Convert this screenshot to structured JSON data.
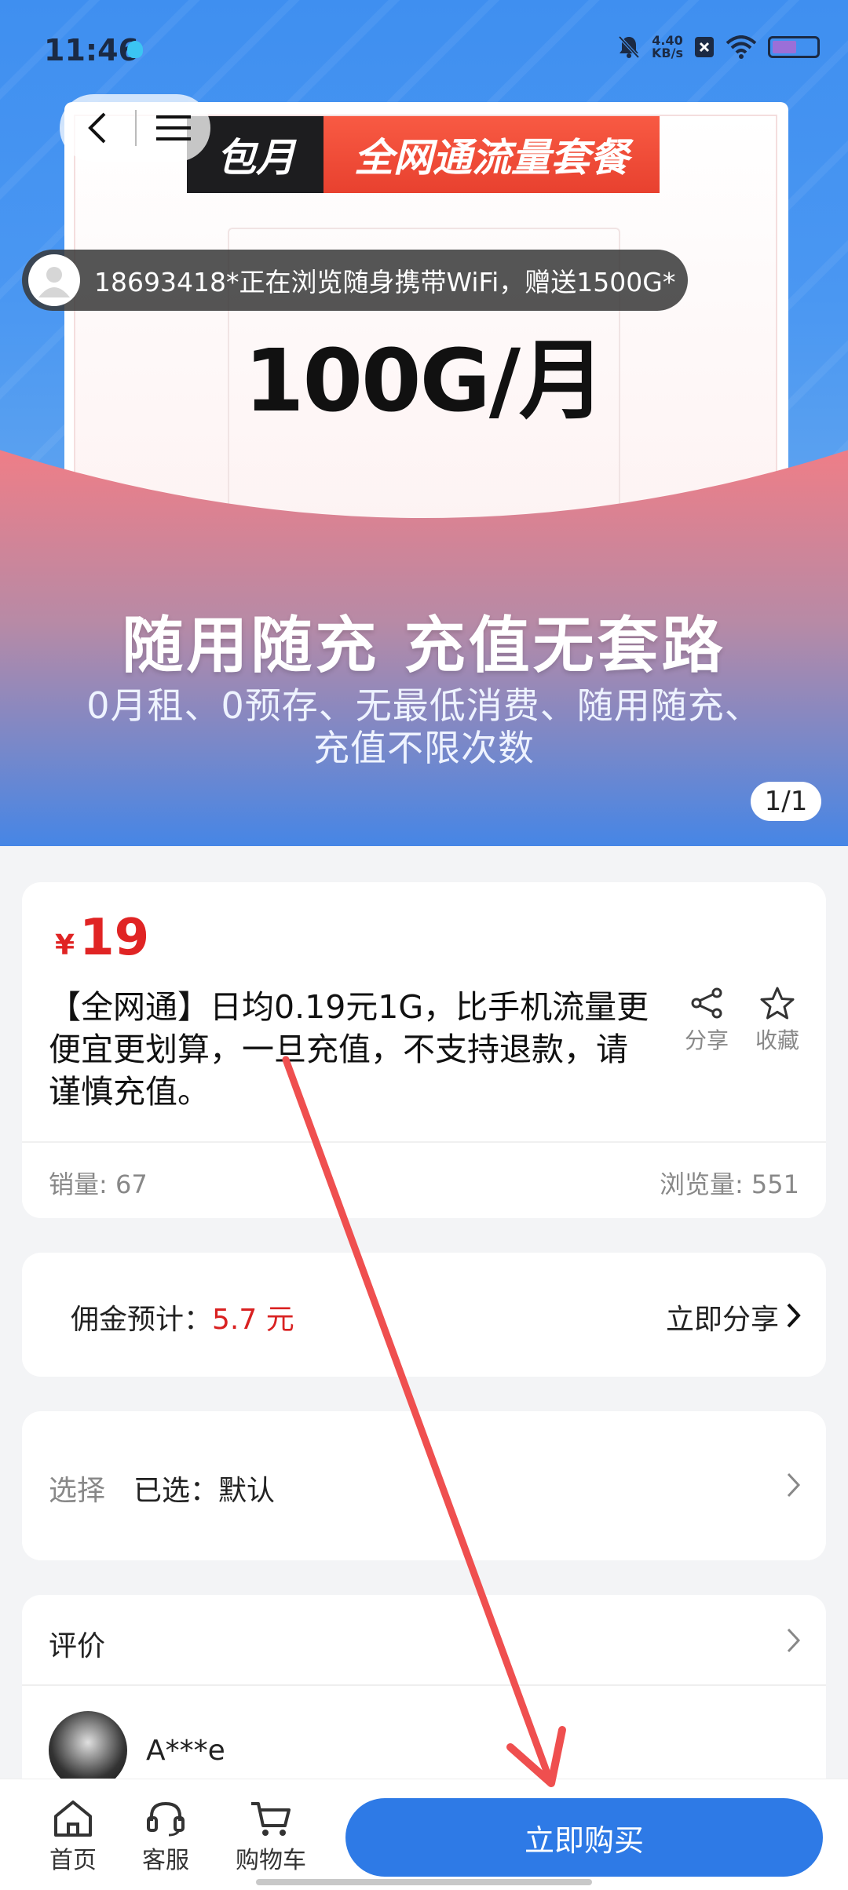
{
  "status": {
    "time": "11:46",
    "net_speed_value": "4.40",
    "net_speed_unit": "KB/s"
  },
  "banner": {
    "tag_left": "包月",
    "tag_right": "全网通流量套餐",
    "amount": "100G/月",
    "slogan": "随用随充  充值无套路",
    "subtitle": "0月租、0预存、无最低消费、随用随充、充值不限次数",
    "pager": "1/1"
  },
  "toast": {
    "text": "18693418*正在浏览随身携带WiFi，赠送1500G*"
  },
  "product": {
    "currency": "¥",
    "price": "19",
    "title": "【全网通】日均0.19元1G，比手机流量更便宜更划算，一旦充值，不支持退款，请谨慎充值。",
    "share_label": "分享",
    "favorite_label": "收藏",
    "sales": "销量: 67",
    "views": "浏览量: 551"
  },
  "commission": {
    "label": "佣金预计：",
    "value": "5.7 元",
    "share_now": "立即分享"
  },
  "selection": {
    "label": "选择",
    "selected": "已选：默认"
  },
  "reviews": {
    "title": "评价",
    "reviewer_name": "A***e"
  },
  "bottom_nav": {
    "home": "首页",
    "service": "客服",
    "cart": "购物车",
    "buy": "立即购买"
  },
  "colors": {
    "accent": "#2e7ae6",
    "price": "#e02424",
    "banner": "#4a97f2",
    "annotation_arrow": "#ef4f4f"
  }
}
